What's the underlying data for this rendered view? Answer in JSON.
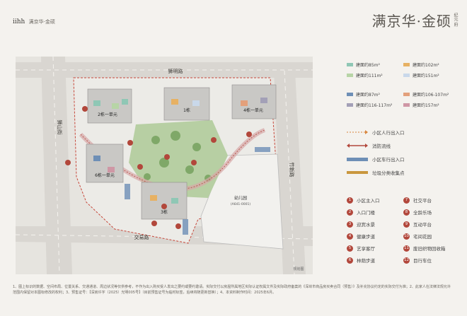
{
  "header": {
    "logo_mark": "iihh",
    "logo_text": "满京华·金硕",
    "brand_title": "满京华·金硕",
    "brand_sub": "纪元 府"
  },
  "map": {
    "roads": {
      "north": "狮明路",
      "west": "狮山街",
      "south": "交易路",
      "east": "竹新路"
    },
    "buildings": {
      "b1": "1栋",
      "b2": "2栋一单元",
      "b3": "3栋",
      "b4": "4栋一单元",
      "b5": "5栋",
      "b6": "6栋一单元",
      "kindergarten": "幼儿园",
      "kindergarten_sub": "(A641-0001)"
    },
    "corner_label": "规划图"
  },
  "legend": {
    "areas": [
      {
        "label": "建面约85m²",
        "color": "#8fc7b5"
      },
      {
        "label": "建面约102m²",
        "color": "#e7b163"
      },
      {
        "label": "建面约111m²",
        "color": "#b7d5a6"
      },
      {
        "label": "建面约151m²",
        "color": "#c9d8ea"
      },
      {
        "label": "建面约87m²",
        "color": "#6e8fb6"
      },
      {
        "label": "建面约106-107m²",
        "color": "#e3a07b"
      },
      {
        "label": "建面约116-117m²",
        "color": "#a3a0b7"
      },
      {
        "label": "建面约157m²",
        "color": "#cf97a5"
      }
    ],
    "lines": [
      {
        "label": "小区人行出入口"
      },
      {
        "label": "消防流线"
      },
      {
        "label": "小区车行出入口"
      },
      {
        "label": "垃圾分类收集点"
      }
    ],
    "facilities": [
      {
        "num": "1",
        "label": "小区主入口"
      },
      {
        "num": "2",
        "label": "入口门楼"
      },
      {
        "num": "3",
        "label": "迎宾水景"
      },
      {
        "num": "4",
        "label": "健康步道"
      },
      {
        "num": "5",
        "label": "艺享客厅"
      },
      {
        "num": "6",
        "label": "林荫步道"
      },
      {
        "num": "7",
        "label": "社交平台"
      },
      {
        "num": "8",
        "label": "全龄乐场"
      },
      {
        "num": "9",
        "label": "互动平台"
      },
      {
        "num": "10",
        "label": "宅间花园"
      },
      {
        "num": "11",
        "label": "废旧织物回收箱"
      },
      {
        "num": "12",
        "label": "目行车位"
      }
    ]
  },
  "footnote": "1、图上标识的数据、空间布局、位置关系、交通通道、周边状况等仅供参考，不作为出入购买受人发出之要约或要约邀请。实际交付以房屋所属地区实际认证权属文件及实际政府备案的《深圳市商品房买卖合同（预售）》及补充协议约定的实际交付为准；2、此家人在法律法规允许范围内保留对本图标修改的权利；3、预售证号：【深房许字（2025）光明005号】（目前预售证号为临时标签，后续将随更新替换）；4、本资料制作时间：2025年6月。"
}
